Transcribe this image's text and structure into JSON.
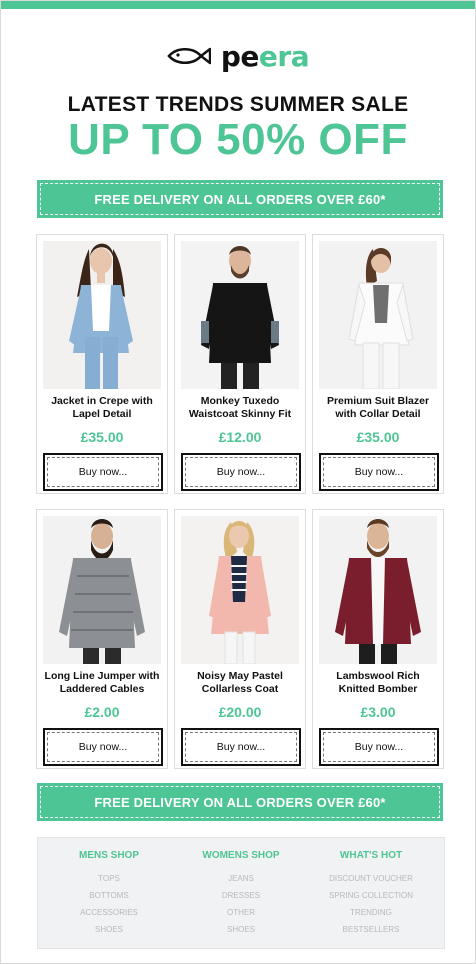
{
  "brand": {
    "name_part1": "pe",
    "name_part2": "era",
    "accent_color": "#4ec594"
  },
  "headline": "LATEST TRENDS SUMMER SALE",
  "sale_text": "UP TO 50% OFF",
  "delivery_banner": "FREE DELIVERY ON ALL ORDERS OVER £60*",
  "products": [
    {
      "name": "Jacket in Crepe with Lapel Detail",
      "price": "£35.00",
      "button": "Buy now..."
    },
    {
      "name": "Monkey Tuxedo Waistcoat Skinny Fit",
      "price": "£12.00",
      "button": "Buy now..."
    },
    {
      "name": "Premium Suit Blazer with Collar Detail",
      "price": "£35.00",
      "button": "Buy now..."
    },
    {
      "name": "Long Line Jumper with Laddered Cables",
      "price": "£2.00",
      "button": "Buy now..."
    },
    {
      "name": "Noisy May Pastel Collarless Coat",
      "price": "£20.00",
      "button": "Buy now..."
    },
    {
      "name": "Lambswool Rich Knitted Bomber",
      "price": "£3.00",
      "button": "Buy now..."
    }
  ],
  "footer": {
    "columns": [
      {
        "heading": "MENS SHOP",
        "links": [
          "TOPS",
          "BOTTOMS",
          "ACCESSORIES",
          "SHOES"
        ]
      },
      {
        "heading": "WOMENS SHOP",
        "links": [
          "JEANS",
          "DRESSES",
          "OTHER",
          "SHOES"
        ]
      },
      {
        "heading": "WHAT'S HOT",
        "links": [
          "DISCOUNT VOUCHER",
          "SPRING COLLECTION",
          "TRENDING",
          "BESTSELLERS"
        ]
      }
    ]
  },
  "icons": {
    "logo": "fish-logo-icon"
  }
}
